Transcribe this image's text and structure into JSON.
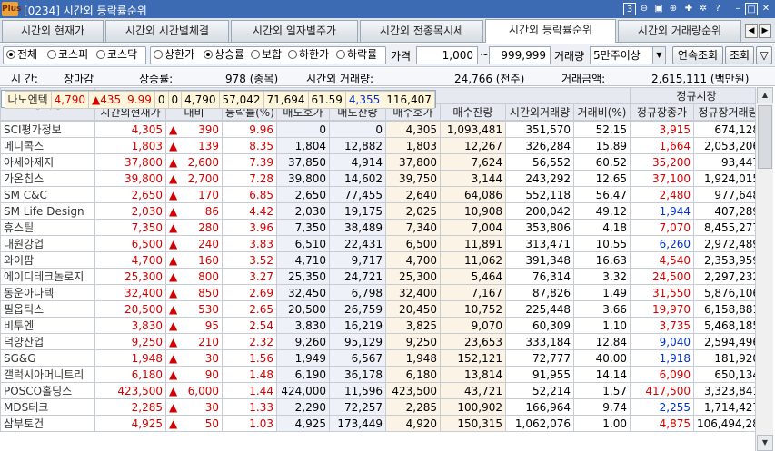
{
  "window": {
    "title": "[0234] 시간외 등락률순위",
    "logo": "Plus",
    "badge": "3"
  },
  "tabs": [
    {
      "label": "시간외 현재가",
      "active": false
    },
    {
      "label": "시간외 시간별체결",
      "active": false
    },
    {
      "label": "시간외 일자별주가",
      "active": false
    },
    {
      "label": "시간외 전종목시세",
      "active": false
    },
    {
      "label": "시간외 등락률순위",
      "active": true
    },
    {
      "label": "시간외 거래량순위",
      "active": false
    }
  ],
  "filter": {
    "market": [
      {
        "label": "전체",
        "on": true
      },
      {
        "label": "코스피",
        "on": false
      },
      {
        "label": "코스닥",
        "on": false
      }
    ],
    "type": [
      {
        "label": "상한가",
        "on": false
      },
      {
        "label": "상승률",
        "on": true
      },
      {
        "label": "보합",
        "on": false
      },
      {
        "label": "하한가",
        "on": false
      },
      {
        "label": "하락률",
        "on": false
      }
    ],
    "price_label": "가격",
    "price_from": "1,000",
    "tilde": "~",
    "price_to": "999,999",
    "volume_label": "거래량",
    "volume_value": "5만주이상",
    "continuous_btn": "연속조회",
    "query_btn": "조회"
  },
  "info": {
    "time_label": "시  간:",
    "time_value": "장마감",
    "rise_label": "상승률:",
    "rise_value": "978 (종목)",
    "vol_label": "시간외 거래량:",
    "vol_value": "24,766 (천주)",
    "amt_label": "거래금액:",
    "amt_value": "2,615,111 (백만원)"
  },
  "headers": {
    "name": "종목명",
    "group1": "시간외 단일가",
    "group2": "정규시장",
    "cols": [
      "시간외현재가",
      "대비",
      "등락률(%)",
      "매도호가",
      "매도잔량",
      "매수호가",
      "매수잔량",
      "시간외거래량",
      "거래비(%)",
      "정규장종가",
      "정규장거래량"
    ]
  },
  "colors": {
    "up": "#d40000",
    "down": "#0030c8",
    "accent": "#3c6bb3"
  },
  "rows": [
    {
      "name": "나노엔텍",
      "price": "4,790",
      "chg": "435",
      "rate": "9.99",
      "ask": "0",
      "askq": "0",
      "bid": "4,790",
      "bidq": "57,042",
      "vol": "71,694",
      "ratio": "61.59",
      "close": "4,355",
      "cdir": "dn",
      "cvol": "116,407",
      "sel": true
    },
    {
      "name": "SCI평가정보",
      "price": "4,305",
      "chg": "390",
      "rate": "9.96",
      "ask": "0",
      "askq": "0",
      "bid": "4,305",
      "bidq": "1,093,481",
      "vol": "351,570",
      "ratio": "52.15",
      "close": "3,915",
      "cdir": "up",
      "cvol": "674,128"
    },
    {
      "name": "메디콕스",
      "price": "1,803",
      "chg": "139",
      "rate": "8.35",
      "ask": "1,804",
      "askq": "12,882",
      "bid": "1,803",
      "bidq": "12,267",
      "vol": "326,284",
      "ratio": "15.89",
      "close": "1,664",
      "cdir": "up",
      "cvol": "2,053,206"
    },
    {
      "name": "아세아제지",
      "price": "37,800",
      "chg": "2,600",
      "rate": "7.39",
      "ask": "37,850",
      "askq": "4,914",
      "bid": "37,800",
      "bidq": "7,624",
      "vol": "56,552",
      "ratio": "60.52",
      "close": "35,200",
      "cdir": "up",
      "cvol": "93,447"
    },
    {
      "name": "가온칩스",
      "price": "39,800",
      "chg": "2,700",
      "rate": "7.28",
      "ask": "39,800",
      "askq": "14,602",
      "bid": "39,750",
      "bidq": "3,144",
      "vol": "243,292",
      "ratio": "12.65",
      "close": "37,100",
      "cdir": "up",
      "cvol": "1,924,015"
    },
    {
      "name": "SM C&C",
      "price": "2,650",
      "chg": "170",
      "rate": "6.85",
      "ask": "2,650",
      "askq": "77,455",
      "bid": "2,640",
      "bidq": "64,086",
      "vol": "552,118",
      "ratio": "56.47",
      "close": "2,480",
      "cdir": "up",
      "cvol": "977,648"
    },
    {
      "name": "SM Life Design",
      "price": "2,030",
      "chg": "86",
      "rate": "4.42",
      "ask": "2,030",
      "askq": "19,175",
      "bid": "2,025",
      "bidq": "10,908",
      "vol": "200,042",
      "ratio": "49.12",
      "close": "1,944",
      "cdir": "dn",
      "cvol": "407,289"
    },
    {
      "name": "휴스틸",
      "price": "7,350",
      "chg": "280",
      "rate": "3.96",
      "ask": "7,350",
      "askq": "38,489",
      "bid": "7,340",
      "bidq": "7,004",
      "vol": "353,806",
      "ratio": "4.18",
      "close": "7,070",
      "cdir": "up",
      "cvol": "8,455,277"
    },
    {
      "name": "대원강업",
      "price": "6,500",
      "chg": "240",
      "rate": "3.83",
      "ask": "6,510",
      "askq": "22,431",
      "bid": "6,500",
      "bidq": "11,891",
      "vol": "313,471",
      "ratio": "10.55",
      "close": "6,260",
      "cdir": "dn",
      "cvol": "2,972,489"
    },
    {
      "name": "와이팜",
      "price": "4,700",
      "chg": "160",
      "rate": "3.52",
      "ask": "4,710",
      "askq": "9,717",
      "bid": "4,700",
      "bidq": "11,062",
      "vol": "391,348",
      "ratio": "16.63",
      "close": "4,540",
      "cdir": "up",
      "cvol": "2,353,959"
    },
    {
      "name": "에이디테크놀로지",
      "price": "25,300",
      "chg": "800",
      "rate": "3.27",
      "ask": "25,350",
      "askq": "24,721",
      "bid": "25,300",
      "bidq": "5,464",
      "vol": "76,314",
      "ratio": "3.32",
      "close": "24,500",
      "cdir": "up",
      "cvol": "2,297,232"
    },
    {
      "name": "동운아나텍",
      "price": "32,400",
      "chg": "850",
      "rate": "2.69",
      "ask": "32,450",
      "askq": "6,798",
      "bid": "32,400",
      "bidq": "7,167",
      "vol": "87,826",
      "ratio": "1.49",
      "close": "31,550",
      "cdir": "up",
      "cvol": "5,876,106"
    },
    {
      "name": "필옵틱스",
      "price": "20,500",
      "chg": "530",
      "rate": "2.65",
      "ask": "20,500",
      "askq": "26,759",
      "bid": "20,450",
      "bidq": "10,752",
      "vol": "225,448",
      "ratio": "3.66",
      "close": "19,970",
      "cdir": "up",
      "cvol": "6,158,881"
    },
    {
      "name": "비투엔",
      "price": "3,830",
      "chg": "95",
      "rate": "2.54",
      "ask": "3,830",
      "askq": "16,219",
      "bid": "3,825",
      "bidq": "9,070",
      "vol": "60,309",
      "ratio": "1.10",
      "close": "3,735",
      "cdir": "up",
      "cvol": "5,468,185"
    },
    {
      "name": "덕양산업",
      "price": "9,250",
      "chg": "210",
      "rate": "2.32",
      "ask": "9,260",
      "askq": "95,129",
      "bid": "9,250",
      "bidq": "23,653",
      "vol": "333,184",
      "ratio": "12.84",
      "close": "9,040",
      "cdir": "dn",
      "cvol": "2,594,496"
    },
    {
      "name": "SG&G",
      "price": "1,948",
      "chg": "30",
      "rate": "1.56",
      "ask": "1,949",
      "askq": "6,567",
      "bid": "1,948",
      "bidq": "152,121",
      "vol": "72,777",
      "ratio": "40.00",
      "close": "1,918",
      "cdir": "dn",
      "cvol": "181,920"
    },
    {
      "name": "갤럭시아머니트리",
      "price": "6,180",
      "chg": "90",
      "rate": "1.48",
      "ask": "6,190",
      "askq": "36,178",
      "bid": "6,180",
      "bidq": "13,814",
      "vol": "91,955",
      "ratio": "14.14",
      "close": "6,090",
      "cdir": "up",
      "cvol": "650,134"
    },
    {
      "name": "POSCO홀딩스",
      "price": "423,500",
      "chg": "6,000",
      "rate": "1.44",
      "ask": "424,000",
      "askq": "11,596",
      "bid": "423,500",
      "bidq": "43,721",
      "vol": "52,214",
      "ratio": "1.57",
      "close": "417,500",
      "cdir": "up",
      "cvol": "3,323,841"
    },
    {
      "name": "MDS테크",
      "price": "2,285",
      "chg": "30",
      "rate": "1.33",
      "ask": "2,290",
      "askq": "72,257",
      "bid": "2,285",
      "bidq": "100,902",
      "vol": "166,964",
      "ratio": "9.74",
      "close": "2,255",
      "cdir": "dn",
      "cvol": "1,714,427"
    },
    {
      "name": "삼부토건",
      "price": "4,925",
      "chg": "50",
      "rate": "1.03",
      "ask": "4,925",
      "askq": "173,449",
      "bid": "4,920",
      "bidq": "150,315",
      "vol": "1,062,076",
      "ratio": "1.00",
      "close": "4,875",
      "cdir": "up",
      "cvol": "106,494,281"
    }
  ]
}
